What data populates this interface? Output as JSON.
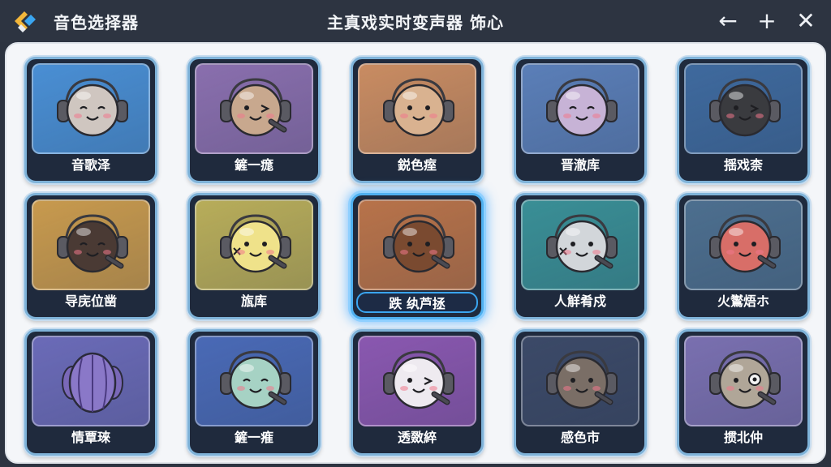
{
  "app": {
    "title": "音色选择器",
    "center_title": "主真戏实时变声器 饰心",
    "logo_icon": "app-logo-icon"
  },
  "window_controls": {
    "back_glyph": "←",
    "add_glyph": "+",
    "close_glyph": "✕"
  },
  "voices": [
    {
      "label": "音歌泽",
      "bg": "#4a8fd4",
      "face": "#cfc6c0",
      "expr": "sleepy",
      "selected": false
    },
    {
      "label": "鏟一痝",
      "bg": "#8a6fae",
      "face": "#c8a88e",
      "expr": "wink-mic",
      "selected": false
    },
    {
      "label": "鋭色痓",
      "bg": "#c98c62",
      "face": "#d9b290",
      "expr": "smile",
      "selected": false
    },
    {
      "label": "晋澈库",
      "bg": "#5b7fb8",
      "face": "#c7b3d6",
      "expr": "happy",
      "selected": false
    },
    {
      "label": "揺戏柰",
      "bg": "#3f6a9e",
      "face": "#3a3b3f",
      "expr": "wink",
      "selected": false
    },
    {
      "label": "导庑位凿",
      "bg": "#c89a4e",
      "face": "#4a3a34",
      "expr": "happy-mic",
      "selected": false
    },
    {
      "label": "旊库",
      "bg": "#b8ad5a",
      "face": "#efe28a",
      "expr": "mark-mic",
      "selected": false
    },
    {
      "label": "跌 纨芦拯",
      "bg": "#b8734a",
      "face": "#7a4a30",
      "expr": "smile-mic",
      "selected": true
    },
    {
      "label": "人觧肴戍",
      "bg": "#3a8f96",
      "face": "#d2d6da",
      "expr": "mark-mic",
      "selected": false
    },
    {
      "label": "火鸑焐ホ",
      "bg": "#4d6f8f",
      "face": "#d86e68",
      "expr": "smile-mic",
      "selected": false
    },
    {
      "label": "情覃琜",
      "bg": "#6b6bb8",
      "face": "#8a78c8",
      "expr": "shell",
      "selected": false
    },
    {
      "label": "鏟一痽",
      "bg": "#4a6ab6",
      "face": "#a6d2c4",
      "expr": "happy-mic",
      "selected": false
    },
    {
      "label": "透敪綷",
      "bg": "#8a58b0",
      "face": "#eeeaf0",
      "expr": "wink-mic",
      "selected": false
    },
    {
      "label": "感色市",
      "bg": "#3c4a68",
      "face": "#7a6e66",
      "expr": "smile-mic",
      "selected": false
    },
    {
      "label": "掼北仲",
      "bg": "#7a70b0",
      "face": "#b0a698",
      "expr": "monocle-mic",
      "selected": false
    }
  ]
}
